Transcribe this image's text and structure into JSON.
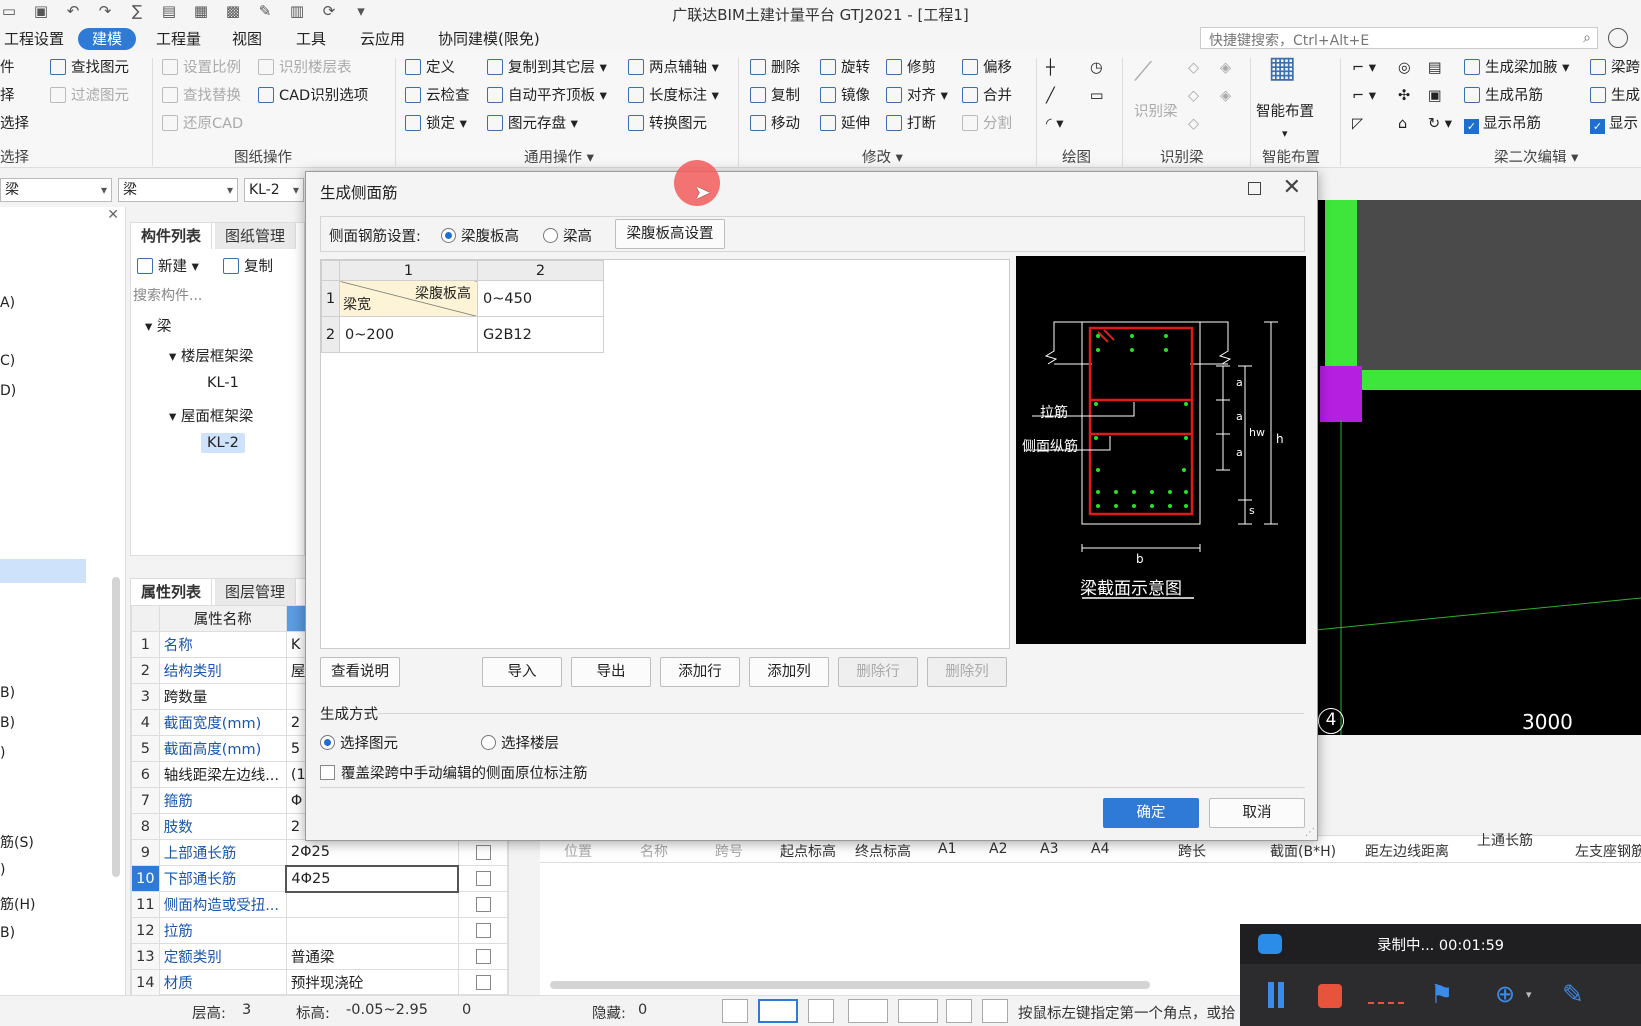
{
  "window": {
    "title": "广联达BIM土建计量平台 GTJ2021 - [工程1]"
  },
  "menu": {
    "tabs": [
      "工程设置",
      "建模",
      "工程量",
      "视图",
      "工具",
      "云应用",
      "协同建模(限免)"
    ],
    "active": "建模",
    "search_placeholder": "快捷键搜索，Ctrl+Alt+E"
  },
  "ribbon": {
    "col0": [
      "件",
      "择",
      "选择"
    ],
    "select_group": "选择",
    "find_element": "查找图元",
    "filter_element": "过滤图元",
    "drawing_group": {
      "title": "图纸操作",
      "set_scale": "设置比例",
      "identify_floor": "识别楼层表",
      "find_replace": "查找替换",
      "cad_options": "CAD识别选项",
      "restore_cad": "还原CAD"
    },
    "general_group": {
      "title": "通用操作",
      "define": "定义",
      "copy_other_floor": "复制到其它层",
      "two_point_axis": "两点辅轴",
      "cloud_check": "云检查",
      "auto_align_top": "自动平齐顶板",
      "length_mark": "长度标注",
      "lock": "锁定",
      "save_element": "图元存盘",
      "convert_element": "转换图元"
    },
    "modify_group": {
      "title": "修改",
      "delete": "删除",
      "rotate": "旋转",
      "trim": "修剪",
      "offset": "偏移",
      "copy": "复制",
      "mirror": "镜像",
      "align": "对齐",
      "merge": "合并",
      "move": "移动",
      "extend": "延伸",
      "break": "打断",
      "split": "分割"
    },
    "draw_group": {
      "title": "绘图"
    },
    "identify_beam_group": {
      "title": "识别梁",
      "identify_beam": "识别梁"
    },
    "smart_layout_group": {
      "title": "智能布置",
      "smart_layout": "智能布置"
    },
    "beam_edit_group": {
      "title": "梁二次编辑",
      "gen_haunch": "生成梁加腋",
      "gen_hanger": "生成吊筋",
      "show_hanger": "显示吊筋",
      "beam_span": "梁跨",
      "gen_short": "生成",
      "show_short": "显示"
    }
  },
  "combos": {
    "c1": "梁",
    "c2": "梁",
    "c3": "KL-2"
  },
  "left_nav": {
    "items": [
      "A)",
      "C)",
      "D)",
      "B)",
      "B)",
      ")",
      "筋(S)",
      ")",
      "筋(H)",
      "B)"
    ]
  },
  "component_panel": {
    "tabs": [
      "构件列表",
      "图纸管理"
    ],
    "new": "新建",
    "copy": "复制",
    "search_placeholder": "搜索构件...",
    "tree": {
      "root": "梁",
      "group1": "楼层框架梁",
      "item1": "KL-1",
      "group2": "屋面框架梁",
      "item2": "KL-2"
    }
  },
  "property_panel": {
    "tabs": [
      "属性列表",
      "图层管理"
    ],
    "header": "属性名称",
    "rows": [
      {
        "no": "1",
        "name": "名称",
        "value": "K"
      },
      {
        "no": "2",
        "name": "结构类别",
        "value": "屋"
      },
      {
        "no": "3",
        "name": "跨数量",
        "value": ""
      },
      {
        "no": "4",
        "name": "截面宽度(mm)",
        "value": "2"
      },
      {
        "no": "5",
        "name": "截面高度(mm)",
        "value": "5"
      },
      {
        "no": "6",
        "name": "轴线距梁左边线...",
        "value": "(1"
      },
      {
        "no": "7",
        "name": "箍筋",
        "value": "Φ"
      },
      {
        "no": "8",
        "name": "肢数",
        "value": "2"
      },
      {
        "no": "9",
        "name": "上部通长筋",
        "value": "2Φ25"
      },
      {
        "no": "10",
        "name": "下部通长筋",
        "value": "4Φ25"
      },
      {
        "no": "11",
        "name": "侧面构造或受扭...",
        "value": ""
      },
      {
        "no": "12",
        "name": "拉筋",
        "value": ""
      },
      {
        "no": "13",
        "name": "定额类别",
        "value": "普通梁"
      },
      {
        "no": "14",
        "name": "材质",
        "value": "预拌现浇砼"
      }
    ]
  },
  "bottom_grid": {
    "headers": [
      "位置",
      "名称",
      "跨号",
      "起点标高",
      "终点标高",
      "A1",
      "A2",
      "A3",
      "A4",
      "跨长",
      "截面(B*H)",
      "距左边线距离",
      "上通长筋",
      "左支座钢筋"
    ]
  },
  "canvas": {
    "axis_label": "4",
    "dimension": "3000"
  },
  "dialog": {
    "title": "生成侧面筋",
    "setting_label": "侧面钢筋设置:",
    "opt_web_height": "梁腹板高",
    "opt_beam_height": "梁高",
    "web_height_setting_btn": "梁腹板高设置",
    "table": {
      "col_headers": [
        "1",
        "2"
      ],
      "corner_top_right": "梁腹板高",
      "corner_bottom_left": "梁宽",
      "row_numbers": [
        "1",
        "2"
      ],
      "col2_header_value": "0~450",
      "row2_width": "0~200",
      "row2_value": "G2B12"
    },
    "schema": {
      "caption": "梁截面示意图",
      "tie_label": "拉筋",
      "side_bar_label": "侧面纵筋",
      "a": "a",
      "hw": "hw",
      "h": "h",
      "s": "s",
      "b": "b"
    },
    "buttons": {
      "view_doc": "查看说明",
      "import": "导入",
      "export": "导出",
      "add_row": "添加行",
      "add_col": "添加列",
      "del_row": "删除行",
      "del_col": "删除列",
      "ok": "确定",
      "cancel": "取消"
    },
    "gen_mode_label": "生成方式",
    "gen_opt_element": "选择图元",
    "gen_opt_floor": "选择楼层",
    "override_checkbox": "覆盖梁跨中手动编辑的侧面原位标注筋"
  },
  "statusbar": {
    "floor_height_label": "层高:",
    "floor_height": "3",
    "elevation_label": "标高:",
    "elevation": "-0.05~2.95",
    "count": "0",
    "hidden_label": "隐藏:",
    "hidden": "0",
    "hint": "按鼠标左键指定第一个角点，或拾"
  },
  "recorder": {
    "text": "录制中... 00:01:59"
  },
  "colors": {
    "accent": "#2f7ad6",
    "canvas_green": "#3ee53a",
    "canvas_magenta": "#b41fe0",
    "rebar_red": "#e01a1a",
    "rebar_green": "#28e028",
    "cursor_circle": "#f26a6a"
  }
}
